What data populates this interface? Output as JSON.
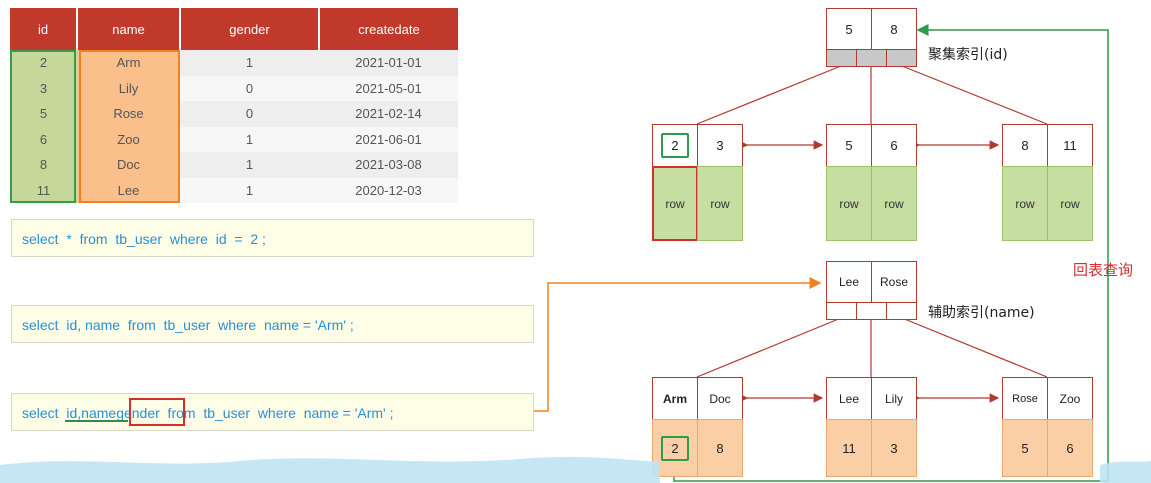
{
  "table": {
    "headers": [
      "id",
      "name",
      "gender",
      "createdate"
    ],
    "rows": [
      {
        "id": "2",
        "name": "Arm",
        "gender": "1",
        "createdate": "2021-01-01"
      },
      {
        "id": "3",
        "name": "Lily",
        "gender": "0",
        "createdate": "2021-05-01"
      },
      {
        "id": "5",
        "name": "Rose",
        "gender": "0",
        "createdate": "2021-02-14"
      },
      {
        "id": "6",
        "name": "Zoo",
        "gender": "1",
        "createdate": "2021-06-01"
      },
      {
        "id": "8",
        "name": "Doc",
        "gender": "1",
        "createdate": "2021-03-08"
      },
      {
        "id": "11",
        "name": "Lee",
        "gender": "1",
        "createdate": "2020-12-03"
      }
    ]
  },
  "queries": {
    "q1": "select  *  from  tb_user  where  id  =  2 ;",
    "q2": "select  id, name  from  tb_user  where  name = 'Arm' ;",
    "q3_a": "select  ",
    "q3_id": "id",
    "q3_comma": ",",
    "q3_name": "name",
    "q3_gender": "gender",
    "q3_b": "  from  tb_user  where  name = 'Arm' ;"
  },
  "clustered": {
    "label": "聚集索引(id)",
    "root": [
      "5",
      "8"
    ],
    "leaves": [
      {
        "keys": [
          "2",
          "3"
        ],
        "rows": [
          "row",
          "row"
        ]
      },
      {
        "keys": [
          "5",
          "6"
        ],
        "rows": [
          "row",
          "row"
        ]
      },
      {
        "keys": [
          "8",
          "11"
        ],
        "rows": [
          "row",
          "row"
        ]
      }
    ]
  },
  "secondary": {
    "label": "辅助索引(name)",
    "root": [
      "Lee",
      "Rose"
    ],
    "leaves": [
      {
        "keys": [
          "Arm",
          "Doc"
        ],
        "ids": [
          "2",
          "8"
        ]
      },
      {
        "keys": [
          "Lee",
          "Lily"
        ],
        "ids": [
          "11",
          "3"
        ]
      },
      {
        "keys": [
          "Rose",
          "Zoo"
        ],
        "ids": [
          "5",
          "6"
        ]
      }
    ]
  },
  "lookup_label": "回表查询",
  "colors": {
    "header": "#c0392b",
    "green": "#3a9a54",
    "orange": "#f08020",
    "red": "#d32f2f"
  }
}
